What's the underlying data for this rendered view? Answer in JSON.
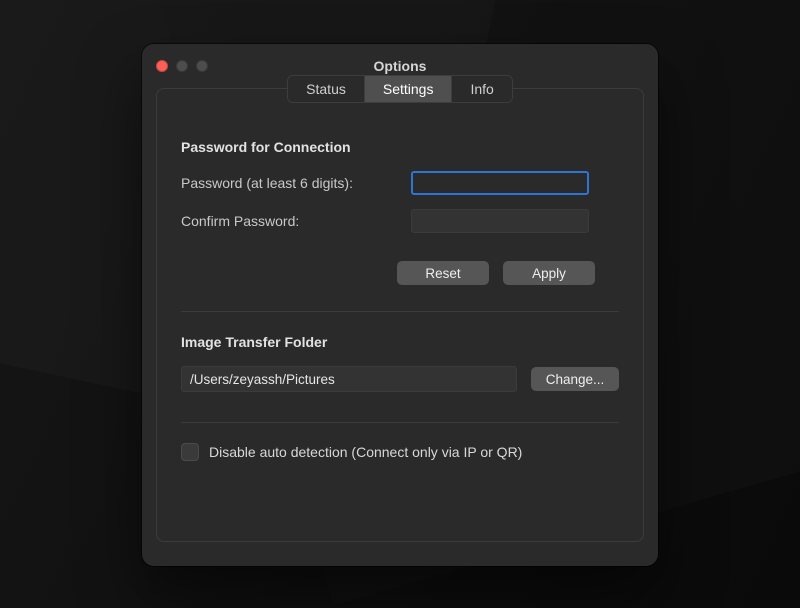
{
  "window": {
    "title": "Options"
  },
  "tabs": {
    "status": "Status",
    "settings": "Settings",
    "info": "Info",
    "active": "settings"
  },
  "password": {
    "section_title": "Password for Connection",
    "label": "Password (at least 6 digits):",
    "confirm_label": "Confirm Password:",
    "value": "",
    "confirm_value": "",
    "reset_label": "Reset",
    "apply_label": "Apply"
  },
  "transfer": {
    "section_title": "Image Transfer Folder",
    "path": "/Users/zeyassh/Pictures",
    "change_label": "Change..."
  },
  "autodetect": {
    "checked": false,
    "label": "Disable auto detection (Connect only via IP or QR)"
  }
}
